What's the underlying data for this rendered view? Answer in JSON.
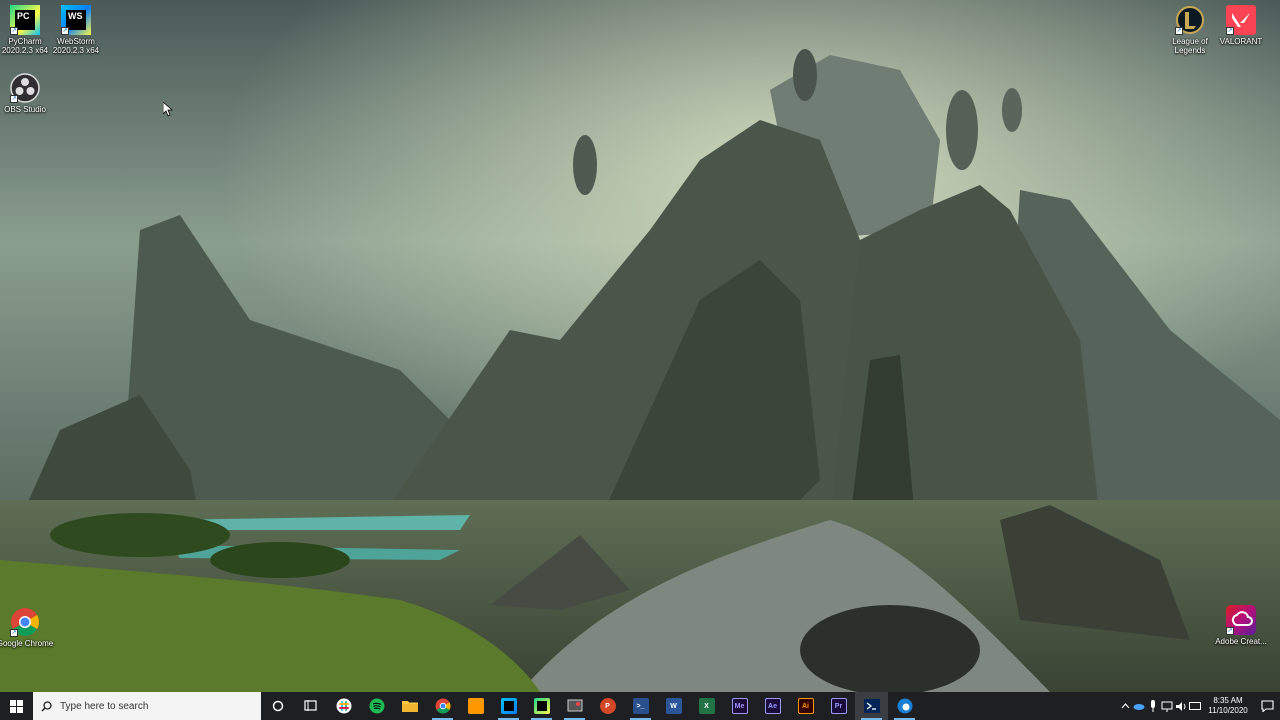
{
  "desktop": {
    "icons": [
      {
        "label": "PyCharm 2020.2.3 x64",
        "icon": "pycharm-icon"
      },
      {
        "label": "WebStorm 2020.2.3 x64",
        "icon": "webstorm-icon"
      },
      {
        "label": "OBS Studio",
        "icon": "obs-icon"
      },
      {
        "label": "League of Legends",
        "icon": "league-icon"
      },
      {
        "label": "VALORANT",
        "icon": "valorant-icon"
      },
      {
        "label": "Google Chrome",
        "icon": "chrome-icon"
      },
      {
        "label": "Adobe Creat...",
        "icon": "adobe-cc-icon"
      }
    ],
    "text_marks": {
      "pycharm": "PC",
      "webstorm": "WS"
    }
  },
  "taskbar": {
    "search_placeholder": "Type here to search",
    "apps": [
      {
        "name": "Spotify",
        "mark": ""
      },
      {
        "name": "File Explorer",
        "mark": ""
      },
      {
        "name": "Google Chrome",
        "mark": ""
      },
      {
        "name": "Sublime Text",
        "mark": ""
      },
      {
        "name": "WebStorm",
        "mark": ""
      },
      {
        "name": "PyCharm",
        "mark": ""
      },
      {
        "name": "Snipping",
        "mark": ""
      },
      {
        "name": "PowerPoint",
        "mark": "P"
      },
      {
        "name": "PowerShell",
        "mark": ">_"
      },
      {
        "name": "Word",
        "mark": "W"
      },
      {
        "name": "Excel",
        "mark": "X"
      },
      {
        "name": "Media Encoder",
        "mark": "Me"
      },
      {
        "name": "After Effects",
        "mark": "Ae"
      },
      {
        "name": "Illustrator",
        "mark": "Ai"
      },
      {
        "name": "Premiere Pro",
        "mark": "Pr"
      }
    ],
    "clock": {
      "time": "8:35 AM",
      "date": "11/10/2020"
    }
  },
  "colors": {
    "taskbar": "#1d1f23",
    "accent": "#76b9ed"
  }
}
